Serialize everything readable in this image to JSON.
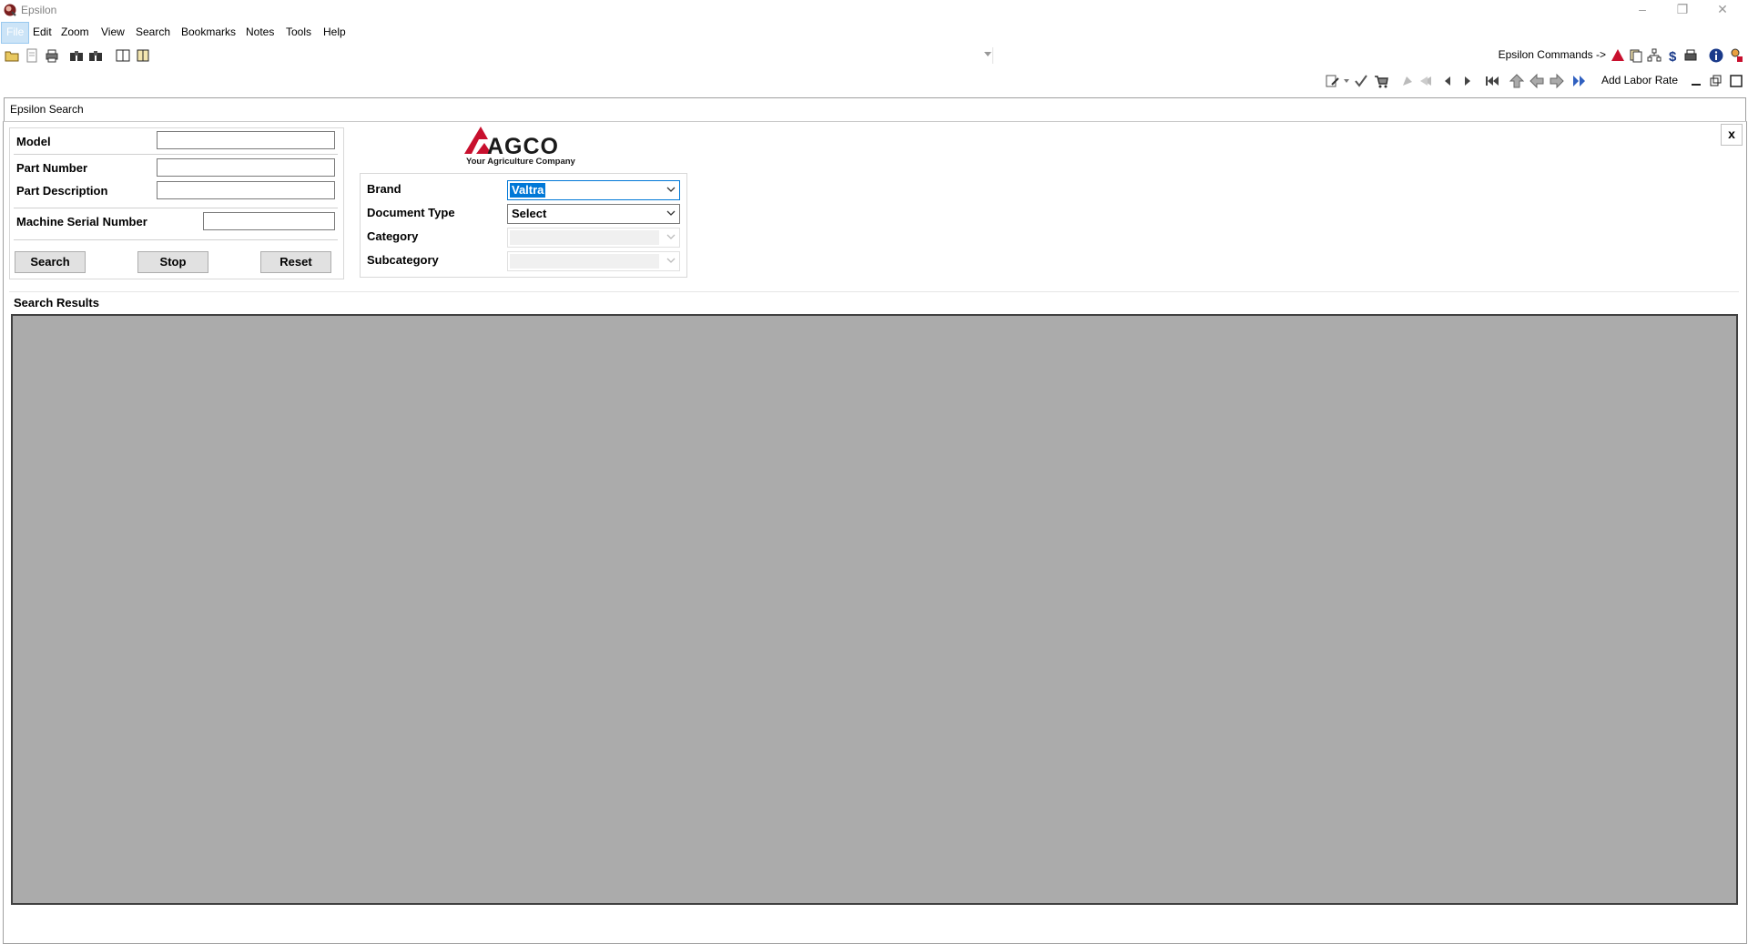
{
  "window": {
    "title": "Epsilon",
    "controls": [
      "minimize",
      "restore",
      "close"
    ]
  },
  "menu": [
    {
      "label": "File",
      "active": true
    },
    {
      "label": "Edit"
    },
    {
      "label": "Zoom"
    },
    {
      "label": "View"
    },
    {
      "label": "Search"
    },
    {
      "label": "Bookmarks"
    },
    {
      "label": "Notes"
    },
    {
      "label": "Tools"
    },
    {
      "label": "Help"
    }
  ],
  "toolbar1": {
    "icons": [
      "open-folder-icon",
      "document-icon",
      "print-icon",
      "search-binoculars-icon",
      "search-binoculars-alt-icon",
      "book-open-icon",
      "book-icon"
    ],
    "commands_label": "Epsilon Commands ->",
    "command_icons": [
      "agco-triangle-icon",
      "copy-icon",
      "tree-icon",
      "dollar-icon",
      "print-setup-icon",
      "info-icon",
      "user-lock-icon"
    ]
  },
  "toolbar2": {
    "icons": [
      "edit-note-icon",
      "checkmark-icon",
      "cart-icon",
      "pan-icon",
      "pan-left-icon",
      "prev-icon",
      "next-icon",
      "first-icon",
      "up-arrow-icon",
      "back-arrow-icon",
      "forward-arrow-icon",
      "forward-double-arrow-icon"
    ],
    "add_labor_rate": "Add Labor Rate",
    "window_icons": [
      "minimize-doc-icon",
      "restore-doc-icon",
      "maximize-doc-icon"
    ]
  },
  "panel": {
    "title": "Epsilon Search",
    "close_label": "x"
  },
  "search_form": {
    "model_label": "Model",
    "model_value": "",
    "part_number_label": "Part Number",
    "part_number_value": "",
    "part_description_label": "Part Description",
    "part_description_value": "",
    "serial_label": "Machine Serial Number",
    "serial_value": "",
    "search_button": "Search",
    "stop_button": "Stop",
    "reset_button": "Reset"
  },
  "logo": {
    "text": "AGCO",
    "tagline": "Your Agriculture Company",
    "color": "#c8102e"
  },
  "filters": {
    "brand_label": "Brand",
    "brand_value": "Valtra",
    "document_type_label": "Document Type",
    "document_type_value": "Select",
    "category_label": "Category",
    "category_value": "",
    "subcategory_label": "Subcategory",
    "subcategory_value": ""
  },
  "results": {
    "title": "Search Results",
    "background": "#ababab"
  }
}
